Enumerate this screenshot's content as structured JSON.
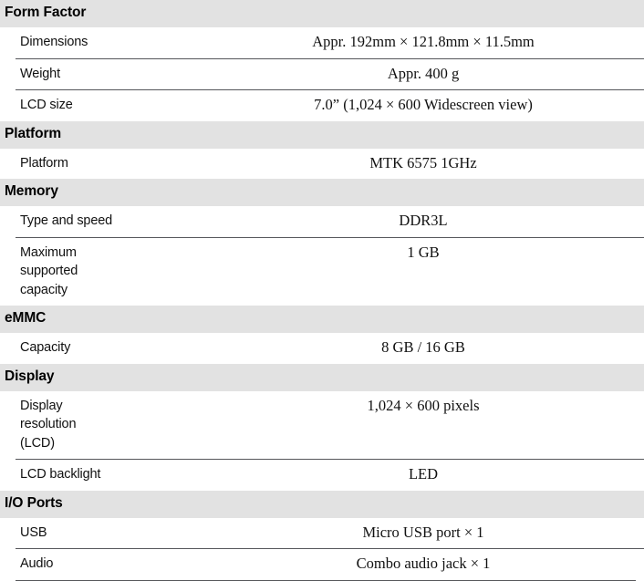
{
  "document": {
    "type": "specification-table",
    "sections": [
      {
        "title": "Form Factor",
        "rows": [
          {
            "label": "Dimensions",
            "value": "Appr. 192mm × 121.8mm × 11.5mm"
          },
          {
            "label": "Weight",
            "value": "Appr. 400 g"
          },
          {
            "label": "LCD size",
            "value": "7.0”  (1,024 × 600 Widescreen view)"
          }
        ]
      },
      {
        "title": "Platform",
        "rows": [
          {
            "label": "Platform",
            "value": "MTK 6575  1GHz"
          }
        ]
      },
      {
        "title": "Memory",
        "rows": [
          {
            "label": "Type and speed",
            "value": "DDR3L"
          },
          {
            "label": "Maximum\nsupported\ncapacity",
            "value": "1 GB"
          }
        ]
      },
      {
        "title": "eMMC",
        "rows": [
          {
            "label": "Capacity",
            "value": "8 GB / 16 GB"
          }
        ]
      },
      {
        "title": "Display",
        "rows": [
          {
            "label": "Display\nresolution\n(LCD)",
            "value": "1,024 × 600 pixels"
          },
          {
            "label": "LCD backlight",
            "value": "LED"
          }
        ]
      },
      {
        "title": "I/O Ports",
        "rows": [
          {
            "label": "USB",
            "value": "Micro USB port × 1"
          },
          {
            "label": "Audio",
            "value": "Combo audio jack × 1"
          }
        ]
      }
    ]
  },
  "colors": {
    "section_header_background": "#e2e2e2",
    "row_background": "#ffffff",
    "rule": "#55565a",
    "text": "#111111"
  }
}
